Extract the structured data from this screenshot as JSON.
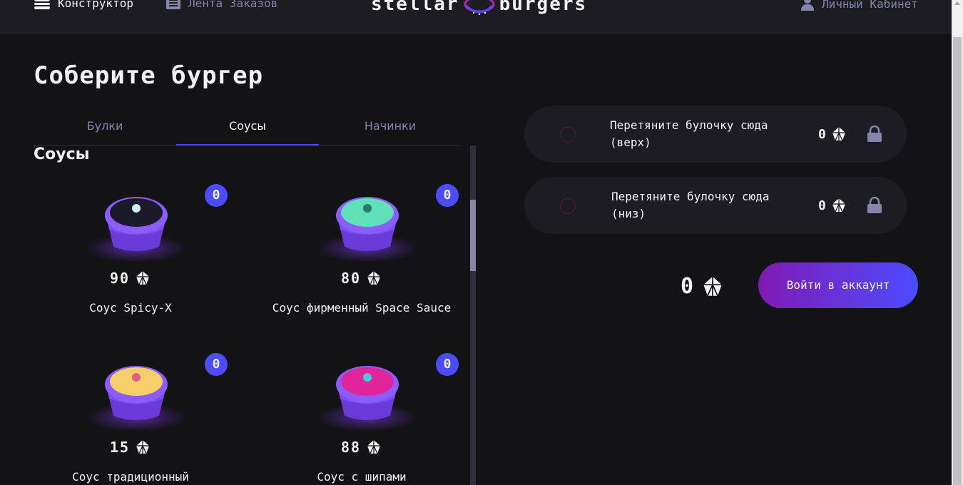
{
  "header": {
    "nav_constructor": "Конструктор",
    "nav_feed": "Лента Заказов",
    "logo_left": "stellar",
    "logo_right": "burgers",
    "profile": "Личный Кабинет"
  },
  "main": {
    "title": "Соберите бургер",
    "tabs": [
      {
        "label": "Булки",
        "active": false
      },
      {
        "label": "Соусы",
        "active": true
      },
      {
        "label": "Начинки",
        "active": false
      }
    ],
    "section_title": "Соусы",
    "ingredients": [
      {
        "name": "Соус Spicy-X",
        "price": "90",
        "count": "0",
        "sauce_color": "#1a1a2a",
        "accent": "#cfe9ff"
      },
      {
        "name": "Соус фирменный Space Sauce",
        "price": "80",
        "count": "0",
        "sauce_color": "#5fe0b8",
        "accent": "#2a7a6a"
      },
      {
        "name": "Соус традиционный",
        "price": "15",
        "count": "0",
        "sauce_color": "#f5d06a",
        "accent": "#e85a8a"
      },
      {
        "name": "Соус с шипами",
        "price": "88",
        "count": "0",
        "sauce_color": "#e0259a",
        "accent": "#49c9d9"
      }
    ]
  },
  "constructor": {
    "bun_top": {
      "text": "Перетяните булочку сюда (верх)",
      "price": "0"
    },
    "bun_bottom": {
      "text": "Перетяните булочку сюда (низ)",
      "price": "0"
    },
    "total": "0",
    "login_button": "Войти в аккаунт"
  },
  "colors": {
    "accent": "#4c4cff",
    "background": "#131316",
    "panel": "#1c1c21",
    "inactive_text": "#8585ad"
  }
}
